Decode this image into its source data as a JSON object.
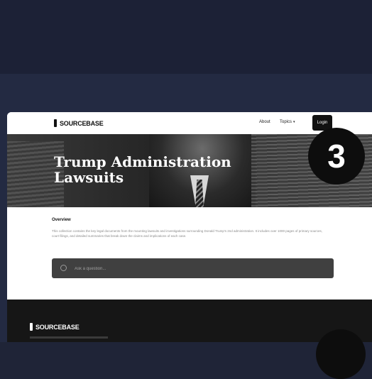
{
  "app": {
    "brand": "SOURCEBASE"
  },
  "nav": {
    "about": "About",
    "topics": "Topics",
    "topics_caret": "▾",
    "login": "Login"
  },
  "hero": {
    "title": "Trump Administration Lawsuits"
  },
  "badge": {
    "number": "3"
  },
  "overview": {
    "heading": "Overview",
    "body": "This collection contains the key legal documents from the mounting lawsuits and investigations surrounding Donald Trump's 2nd administration. It includes over 1000 pages of primary sources, court filings, and detailed summaries that break down the claims and implications of each case."
  },
  "ask": {
    "placeholder": "Ask a question...",
    "icon": "chat-circle-icon"
  },
  "footer": {
    "brand": "SOURCEBASE"
  },
  "colors": {
    "page_bg": "#1f2437",
    "hero_dark": "#1f1f1f",
    "ask_bg": "#404040",
    "footer_bg": "#161616"
  }
}
